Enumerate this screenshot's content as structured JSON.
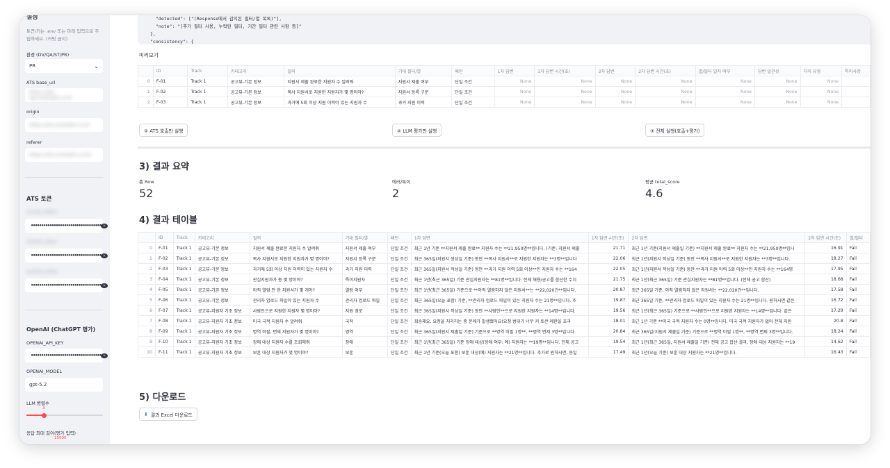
{
  "sidebar": {
    "settings_title": "설정",
    "help_line1": "토큰/키는 .env 또는 아래 입력으로 주",
    "help_line2": "입하세요. (커밋 금지)",
    "env_label": "환경 (DV/QA/ST/PR)",
    "env_value": "PR",
    "ats_base_url_label": "ATS base_url",
    "ats_base_url_value": "https://ats-api.example.co.kr",
    "origin_label": "origin",
    "origin_value": "https://ats.example.co.kr",
    "referer_label": "referer",
    "referer_value": "https://ats.example.co.kr/",
    "ats_token_title": "ATS 토큰",
    "token_field_1_label": "access_token",
    "token_field_2_label": "refresh_token",
    "token_field_3_label": "session_token",
    "masked_value": "••••••••••••••••••••••••••••••••••",
    "openai_title": "OpenAI (ChatGPT 평가)",
    "openai_key_label": "OPENAI_API_KEY",
    "openai_model_label": "OPENAI_MODEL",
    "openai_model_value": "gpt-5.2",
    "llm_parallel_label": "LLM 병렬수",
    "llm_parallel_value": "3",
    "max_len_label": "응답 최대 길이(평가 입력)",
    "max_len_value": "15000"
  },
  "json_preview": {
    "line1": "\"detected\": [\"(Response에서 감지된 필터/열 목록)\"],",
    "line2": "\"note\": \"[추가 필터 사용, 누락된 필터, 기간 필터 관련 사항 등]\"",
    "line3": "},",
    "line4": "\"consistency\": {"
  },
  "preview": {
    "title": "미리보기",
    "columns": [
      "",
      "ID",
      "Track",
      "카테고리",
      "질의",
      "기대 필터/열",
      "패턴",
      "1차 답변",
      "1차 답변 시간(초)",
      "2차 답변",
      "2차 답변 시간(초)",
      "열/필터 일치 여부",
      "답변 일관성",
      "차이 유형",
      "특이사항"
    ],
    "rows": [
      [
        "0",
        "F-01",
        "Track 1",
        "공고뷰-기본 정보",
        "지원서 제출 완료한 지원자 수 알려줘",
        "지원서 제출 여부",
        "단일 조건",
        "None",
        "None",
        "None",
        "None",
        "None",
        "None",
        "None",
        ""
      ],
      [
        "1",
        "F-02",
        "Track 1",
        "공고뷰-기본 정보",
        "복사 지원서로 지원한 지원자가 몇 명이야?",
        "지원서 등록 구분",
        "단일 조건",
        "None",
        "None",
        "None",
        "None",
        "None",
        "None",
        "None",
        ""
      ],
      [
        "2",
        "F-03",
        "Track 1",
        "공고뷰-기본 정보",
        "과거에 5회 이상 지원 이력이 있는 지원자 수",
        "과거 지원 이력",
        "단일 조건",
        "None",
        "None",
        "None",
        "None",
        "None",
        "None",
        "None",
        ""
      ]
    ]
  },
  "buttons": {
    "run_ats": "① ATS 호출만 실행",
    "run_llm": "② LLM 평가만 실행",
    "run_all": "③ 전체 실행(호출+평가)",
    "download_excel": "결과 Excel 다운로드"
  },
  "summary": {
    "title": "3) 결과 요약",
    "total_rows_label": "총 Row",
    "total_rows_value": "52",
    "errors_label": "에러/특이",
    "errors_value": "2",
    "avg_score_label": "평균 total_score",
    "avg_score_value": "4.6"
  },
  "results": {
    "title": "4) 결과 테이블",
    "columns": [
      "",
      "ID",
      "Track",
      "카테고리",
      "질의",
      "기대 필터/열",
      "패턴",
      "1차 답변",
      "1차 답변 시간(초)",
      "2차 답변",
      "2차 답변 시간(초)",
      "열/필터"
    ],
    "rows": [
      [
        "0",
        "F-01",
        "Track 1",
        "공고뷰-기본 정보",
        "지원서 제출 완료한 지원자 수 알려줘",
        "지원서 제출 여부",
        "단일 조건",
        "최근 1년 기준 **지원서 제출 완료** 지원자 수는 **21,950명**입니다. (기준: 지원서 제출",
        "21.71",
        "최근 1년 기준(지원서 제출일 기준) **지원서 제출 완료** 지원자 수는 **21,950명**입니",
        "16.91",
        "Fail"
      ],
      [
        "1",
        "F-02",
        "Track 1",
        "공고뷰-기본 정보",
        "복사 지원서로 지원한 지원자가 몇 명이야?",
        "지원서 등록 구분",
        "단일 조건",
        "최근 365일(지원서 생성일 기준) 동안 **복사 지원서**로 지원한 지원자는 **3명**입니다",
        "22.06",
        "최근 1년(지원서 작성일 기준) 동안 **복사 지원서**로 지원한 지원자는 **3명**입니다.",
        "18.27",
        "Fail"
      ],
      [
        "2",
        "F-03",
        "Track 1",
        "공고뷰-기본 정보",
        "과거에 5회 이상 지원 이력이 있는 지원자 수",
        "과거 지원 이력",
        "단일 조건",
        "최근 365일(지원서 작성일 기준) 동안 **과거 지원 이력 5회 이상**인 지원자 수는 **164",
        "22.05",
        "최근 1년(지원서 작성일 기준) 동안 **과거 지원 이력 5회 이상**인 지원자 수는 **164명",
        "17.95",
        "Fail"
      ],
      [
        "3",
        "F-04",
        "Track 1",
        "공고뷰-기본 정보",
        "관심지원자가 총 몇 명이야?",
        "특이지원자",
        "단일 조건",
        "최근 1년(최근 365일) 기준 관심지원자는 **81명**입니다. 전체 채용/공고를 합산한 수치",
        "21.75",
        "최근 1년(최근 365일) 기준 관심지원자는 **81명**입니다. (전체 공고 합산)",
        "18.68",
        "Fail"
      ],
      [
        "4",
        "F-05",
        "Track 1",
        "공고뷰-기본 정보",
        "아직 열람 안 한 지원서가 몇 개야?",
        "열람 여부",
        "단일 조건",
        "최근 1년(최근 365일) 기준으로 **아직 열람하지 않은 지원서**는 **22,020건**입니다.",
        "20.87",
        "최근 365일 기준, 아직 열람하지 않은 지원서는 **22,020건**입니다.",
        "17.58",
        "Fail"
      ],
      [
        "5",
        "F-06",
        "Track 1",
        "공고뷰-기본 정보",
        "관리자 업로드 파일이 있는 지원자 수",
        "관리자 업로드 파일",
        "단일 조건",
        "최근 365일(오늘 포함) 기준, **관리자 업로드 파일이 있는 지원자 수는 21명**입니다. 추",
        "19.87",
        "최근 365일 기준, **관리자 업로드 파일이 있는 지원자 수는 21명**입니다. 원하시면 같은",
        "16.72",
        "Fail"
      ],
      [
        "6",
        "F-07",
        "Track 1",
        "공고뷰-지원자 기초 정보",
        "사람인으로 지원한 지원자 몇 명이야?",
        "지원 경로",
        "단일 조건",
        "최근 365일(지원서 작성일 기준) 동안 **사람인**으로 지원한 지원자는 **14명**입니다.",
        "19.56",
        "최근 1년(최근 365일) 기준으로 **사람인**으로 지원한 지원자는 **14명**입니다. 같은",
        "17.29",
        "Fail"
      ],
      [
        "7",
        "F-08",
        "Track 1",
        "공고뷰-지원자 기초 정보",
        "미국 국적 지원자 수 알려줘",
        "국적",
        "단일 조건",
        "죄송해요, 요청을 처리하는 중 문제가 발생했어요(요청 범위가 너무 커 토큰 제한을 초과",
        "18.01",
        "최근 1년 기준 **미국 국적 지원자 수는 0명**입니다. 미국 국적 지원자가 없어 전체 지원",
        "20.8",
        "Fail"
      ],
      [
        "8",
        "F-09",
        "Track 1",
        "공고뷰-지원자 기초 정보",
        "병역 미필, 면제 지원자가 몇 명이야?",
        "병역",
        "단일 조건",
        "최근 365일(지원서 제출일 기준) 기준으로 **병역 미필 1명**, **병역 면제 3명**입니다.",
        "20.84",
        "최근 365일(지원서 제출일 기준) 기준으로 **병역 미필 1명**, **병역 면제 3명**입니다.",
        "18.24",
        "Fail"
      ],
      [
        "9",
        "F-10",
        "Track 1",
        "공고뷰-지원자 기초 정보",
        "장애 대상 지원자 수를 조회해줘",
        "장애",
        "단일 조건",
        "최근 1년(최근 365일) 기준 장애 대상(장애 여부: 예) 지원자는 **19명**입니다. 전체 공고",
        "19.54",
        "최근 1년(최근 365일, 지원서 제출일 기준) 전체 공고 합산 결과, 장애 대상 지원자는 **19",
        "14.62",
        "Fail"
      ],
      [
        "10",
        "F-11",
        "Track 1",
        "공고뷰-지원자 기초 정보",
        "보훈 대상 지원자가 몇 명이야?",
        "보훈",
        "단일 조건",
        "최근 1년 기준(오늘 포함) 보훈 대상(예) 지원자는 **21명**입니다. 추가로 원하시면, 동일",
        "17.49",
        "최근 1년(오늘 기준) 보훈 대상 지원자는 **21명**입니다.",
        "16.43",
        "Fail"
      ]
    ]
  },
  "download": {
    "title": "5) 다운로드"
  },
  "colors": {
    "accent": "#ff4b4b",
    "sidebar_bg": "#f0f2f6",
    "text": "#31333f"
  }
}
